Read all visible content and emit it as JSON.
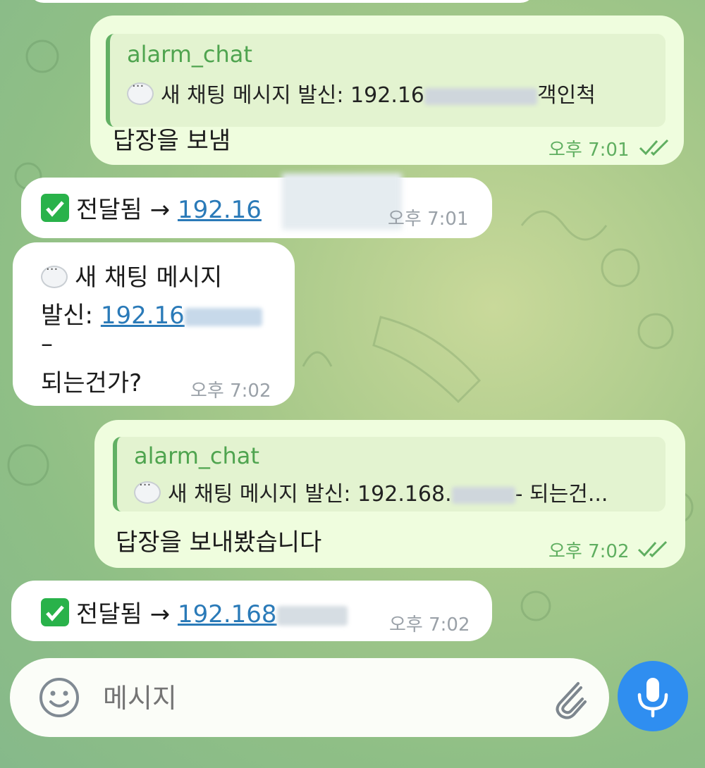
{
  "chat": {
    "msg1": {
      "reply_name": "alarm_chat",
      "reply_prefix": "새 채팅 메시지 발신: 192.16",
      "reply_suffix": "객인척",
      "text": "답장을 보냄",
      "time": "오후 7:01"
    },
    "msg2": {
      "prefix": "전달됨 →",
      "link": "192.16",
      "time": "오후 7:01"
    },
    "msg3": {
      "line1": "새 채팅 메시지",
      "line2_prefix": "발신:",
      "link": "192.16",
      "line3": "–",
      "line4": "되는건가?",
      "time": "오후 7:02"
    },
    "msg4": {
      "reply_name": "alarm_chat",
      "reply_prefix": "새 채팅 메시지 발신: 192.168.",
      "reply_suffix": "- 되는건...",
      "text": "답장을 보내봤습니다",
      "time": "오후 7:02"
    },
    "msg5": {
      "prefix": "전달됨 →",
      "link": "192.168",
      "time": "오후 7:02"
    }
  },
  "input": {
    "placeholder": "메시지"
  },
  "icons": {
    "emoji": "emoji-icon",
    "attach": "paperclip-icon",
    "mic": "microphone-icon",
    "check": "check-mark-icon",
    "speech": "speech-bubble-icon",
    "read": "double-check-icon"
  },
  "colors": {
    "outgoing_bubble": "#effdde",
    "incoming_bubble": "#ffffff",
    "accent_green": "#4fa44f",
    "link": "#2a7ab8",
    "mic_button": "#2f8ef0"
  }
}
